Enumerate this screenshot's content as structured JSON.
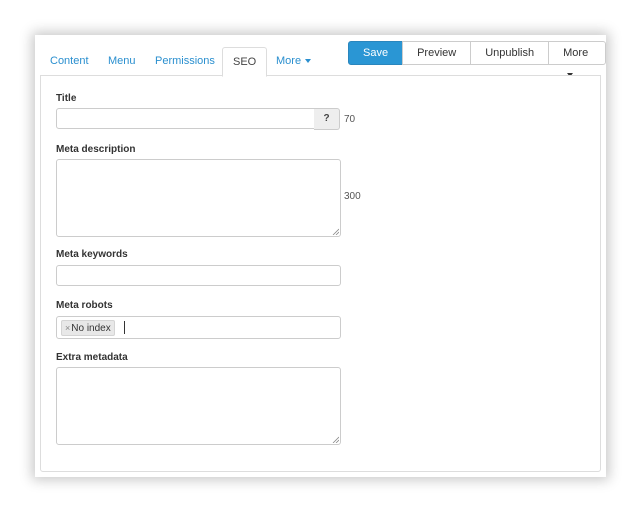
{
  "tabs": [
    {
      "label": "Content"
    },
    {
      "label": "Menu"
    },
    {
      "label": "Permissions"
    },
    {
      "label": "SEO",
      "active": true
    },
    {
      "label": "More"
    }
  ],
  "toolbar": {
    "save": "Save",
    "preview": "Preview",
    "unpublish": "Unpublish",
    "more": "More"
  },
  "form": {
    "title": {
      "label": "Title",
      "value": "",
      "help": "?",
      "counter": "70"
    },
    "meta_description": {
      "label": "Meta description",
      "value": "",
      "counter": "300"
    },
    "meta_keywords": {
      "label": "Meta keywords",
      "value": ""
    },
    "meta_robots": {
      "label": "Meta robots",
      "tags": [
        "No index"
      ],
      "remove_glyph": "×"
    },
    "extra_metadata": {
      "label": "Extra metadata",
      "value": ""
    }
  },
  "colors": {
    "accent": "#2a96d4",
    "link": "#2a8fcf"
  }
}
